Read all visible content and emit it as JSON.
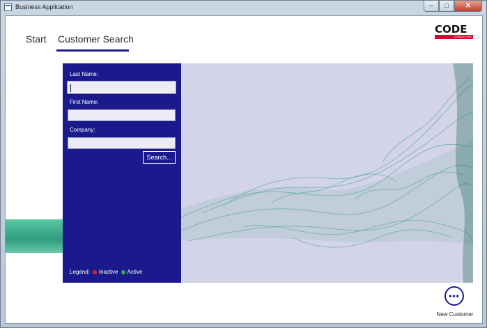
{
  "window": {
    "title": "Business Application",
    "min_glyph": "–",
    "max_glyph": "□",
    "close_glyph": "✕"
  },
  "tabs": [
    {
      "label": "Start",
      "selected": false
    },
    {
      "label": "Customer Search",
      "selected": true
    }
  ],
  "logo": {
    "text": "CODE",
    "subtext": "CONSULTING",
    "accent": "#c8102e"
  },
  "search_form": {
    "last_name_label": "Last Name:",
    "last_name_value": "",
    "first_name_label": "First Name:",
    "first_name_value": "",
    "company_label": "Company:",
    "company_value": "",
    "search_button": "Search..."
  },
  "legend": {
    "label": "Legend:",
    "items": [
      {
        "label": "Inactive",
        "color": "#e01e1e"
      },
      {
        "label": "Active",
        "color": "#27b24a"
      }
    ]
  },
  "new_customer": {
    "icon_glyph": "•••",
    "label": "New Customer"
  },
  "colors": {
    "primary": "#1a1a8c",
    "hero_background": "#d4d4e8",
    "smoke": "#3fa08a"
  }
}
